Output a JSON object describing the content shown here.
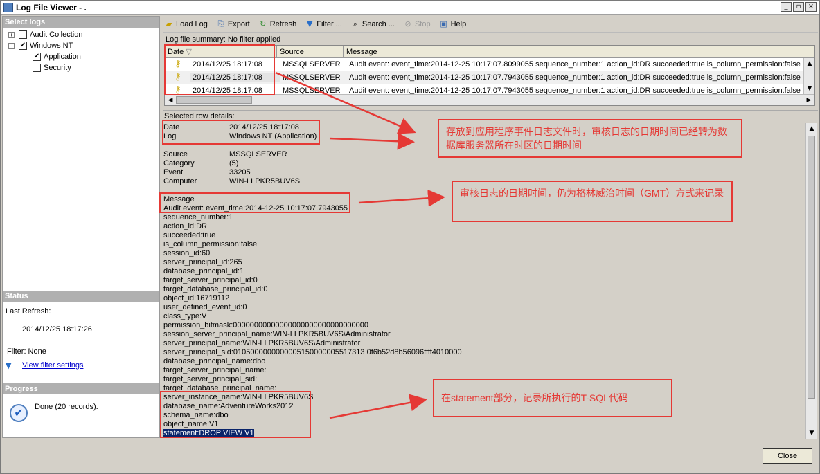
{
  "window": {
    "title": "Log File Viewer - .",
    "controls": {
      "minimize": "_",
      "maximize": "▫",
      "close": "×"
    }
  },
  "select_logs": {
    "header": "Select logs",
    "items": [
      {
        "label": "Audit Collection",
        "expander": "+",
        "checked": false
      },
      {
        "label": "Windows NT",
        "expander": "−",
        "checked": true
      },
      {
        "label": "Application",
        "checked": true
      },
      {
        "label": "Security",
        "checked": false
      }
    ]
  },
  "status": {
    "header": "Status",
    "last_refresh_label": "Last Refresh:",
    "last_refresh_value": "2014/12/25 18:17:26",
    "filter_label": "Filter: None",
    "filter_link": "View filter settings"
  },
  "progress": {
    "header": "Progress",
    "text": "Done (20 records)."
  },
  "toolbar": {
    "load_log": "Load Log",
    "export": "Export",
    "refresh": "Refresh",
    "filter": "Filter ...",
    "search": "Search ...",
    "stop": "Stop",
    "help": "Help"
  },
  "summary": {
    "label": "Log file summary: No filter applied",
    "columns": {
      "date": "Date",
      "source": "Source",
      "message": "Message"
    },
    "rows": [
      {
        "date": "2014/12/25 18:17:08",
        "source": "MSSQLSERVER",
        "message": "Audit event: event_time:2014-12-25 10:17:07.8099055 sequence_number:1 action_id:DR    succeeded:true is_column_permission:false sess"
      },
      {
        "date": "2014/12/25 18:17:08",
        "source": "MSSQLSERVER",
        "message": "Audit event: event_time:2014-12-25 10:17:07.7943055 sequence_number:1 action_id:DR    succeeded:true is_column_permission:false sess"
      },
      {
        "date": "2014/12/25 18:17:08",
        "source": "MSSQLSERVER",
        "message": "Audit event: event_time:2014-12-25 10:17:07.7943055 sequence_number:1 action_id:DR    succeeded:true is_column_permission:false sess"
      }
    ]
  },
  "details": {
    "header": "Selected row details:",
    "date_label": "Date",
    "date_value": "2014/12/25 18:17:08",
    "log_label": "Log",
    "log_value": "Windows NT (Application)",
    "source_label": "Source",
    "source_value": "MSSQLSERVER",
    "category_label": "Category",
    "category_value": "(5)",
    "event_label": "Event",
    "event_value": "33205",
    "computer_label": "Computer",
    "computer_value": "WIN-LLPKR5BUV6S",
    "message_label": "Message",
    "message_lines": [
      "Audit event: event_time:2014-12-25 10:17:07.7943055",
      "sequence_number:1",
      "action_id:DR",
      "succeeded:true",
      "is_column_permission:false",
      "session_id:60",
      "server_principal_id:265",
      "database_principal_id:1",
      "target_server_principal_id:0",
      "target_database_principal_id:0",
      "object_id:16719112",
      "user_defined_event_id:0",
      "class_type:V",
      "permission_bitmask:00000000000000000000000000000000",
      "session_server_principal_name:WIN-LLPKR5BUV6S\\Administrator",
      "server_principal_name:WIN-LLPKR5BUV6S\\Administrator",
      "server_principal_sid:0105000000000005150000005517313 0f6b52d8b56096ffff4010000",
      "database_principal_name:dbo",
      "target_server_principal_name:",
      "target_server_principal_sid:",
      "target_database_principal_name:",
      "server_instance_name:WIN-LLPKR5BUV6S",
      "database_name:AdventureWorks2012",
      "schema_name:dbo",
      "object_name:V1",
      "statement:DROP VIEW V1"
    ]
  },
  "close_button": "Close",
  "annotations": {
    "note1": "存放到应用程序事件日志文件时，审核日志的日期时间已经转为数据库服务器所在时区的日期时间",
    "note2": "审核日志的日期时间，仍为格林威治时间（GMT）方式来记录",
    "note3": "在statement部分，记录所执行的T-SQL代码"
  },
  "colors": {
    "annotation_red": "#e53935",
    "selection": "#0a246a"
  }
}
